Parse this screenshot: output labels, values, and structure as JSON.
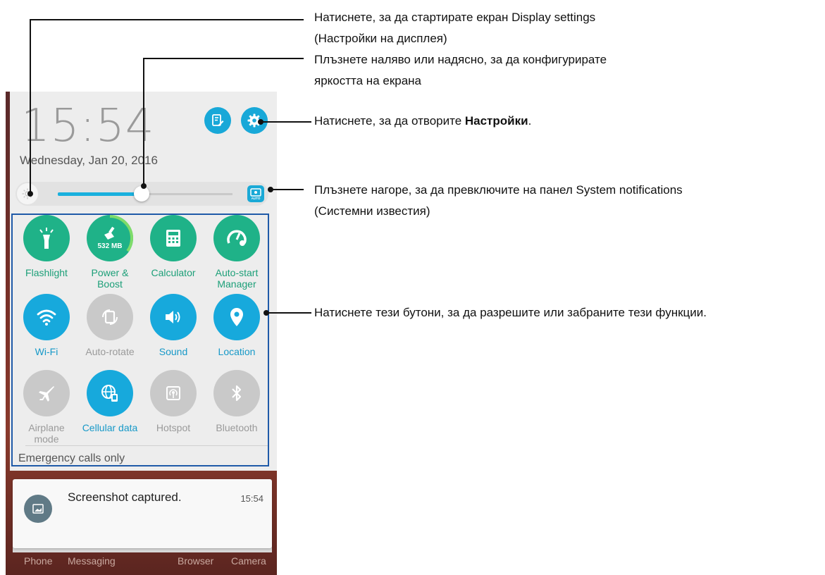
{
  "phone": {
    "clock": "15:54",
    "date": "Wednesday, Jan 20, 2016",
    "brightness": {
      "level": 0.48,
      "auto_label": "AUTO"
    },
    "tiles": [
      {
        "label": "Flashlight",
        "state": "on",
        "icon": "flashlight-icon"
      },
      {
        "label": "Power & Boost",
        "state": "on",
        "icon": "broom-icon",
        "badge": "532 MB"
      },
      {
        "label": "Calculator",
        "state": "on",
        "icon": "calculator-icon"
      },
      {
        "label": "Auto-start Manager",
        "state": "on",
        "icon": "gauge-wrench-icon"
      },
      {
        "label": "Wi-Fi",
        "state": "on",
        "icon": "wifi-icon"
      },
      {
        "label": "Auto-rotate",
        "state": "off",
        "icon": "rotate-icon"
      },
      {
        "label": "Sound",
        "state": "on",
        "icon": "sound-icon"
      },
      {
        "label": "Location",
        "state": "on",
        "icon": "location-pin-icon"
      },
      {
        "label": "Airplane mode",
        "state": "off",
        "icon": "airplane-icon"
      },
      {
        "label": "Cellular data",
        "state": "on",
        "icon": "globe-data-icon"
      },
      {
        "label": "Hotspot",
        "state": "off",
        "icon": "hotspot-icon"
      },
      {
        "label": "Bluetooth",
        "state": "off",
        "icon": "bluetooth-icon"
      }
    ],
    "emergency": "Emergency calls only",
    "notification": {
      "title": "Screenshot captured.",
      "time": "15:54"
    },
    "dock": [
      "Phone",
      "Messaging",
      "Browser",
      "Camera"
    ]
  },
  "callouts": {
    "display_settings_1": "Натиснете, за да стартирате екран Display settings",
    "display_settings_2": "(Настройки на дисплея)",
    "brightness_1": "Плъзнете наляво или надясно, за да конфигурирате",
    "brightness_2": "яркостта на екрана",
    "settings_pre": "Натиснете, за да отворите ",
    "settings_bold": "Настройки",
    "settings_post": ".",
    "system_notif_1": "Плъзнете нагоре, за да превключите на панел System notifications",
    "system_notif_2": "(Системни известия)",
    "toggles": "Натиснете тези бутони, за да разрешите или забраните тези функции."
  },
  "colors": {
    "accent_blue": "#17a9dc",
    "accent_green": "#1fb288",
    "disabled_grey": "#c9c9c9",
    "highlight_border": "#1f5aa8"
  }
}
